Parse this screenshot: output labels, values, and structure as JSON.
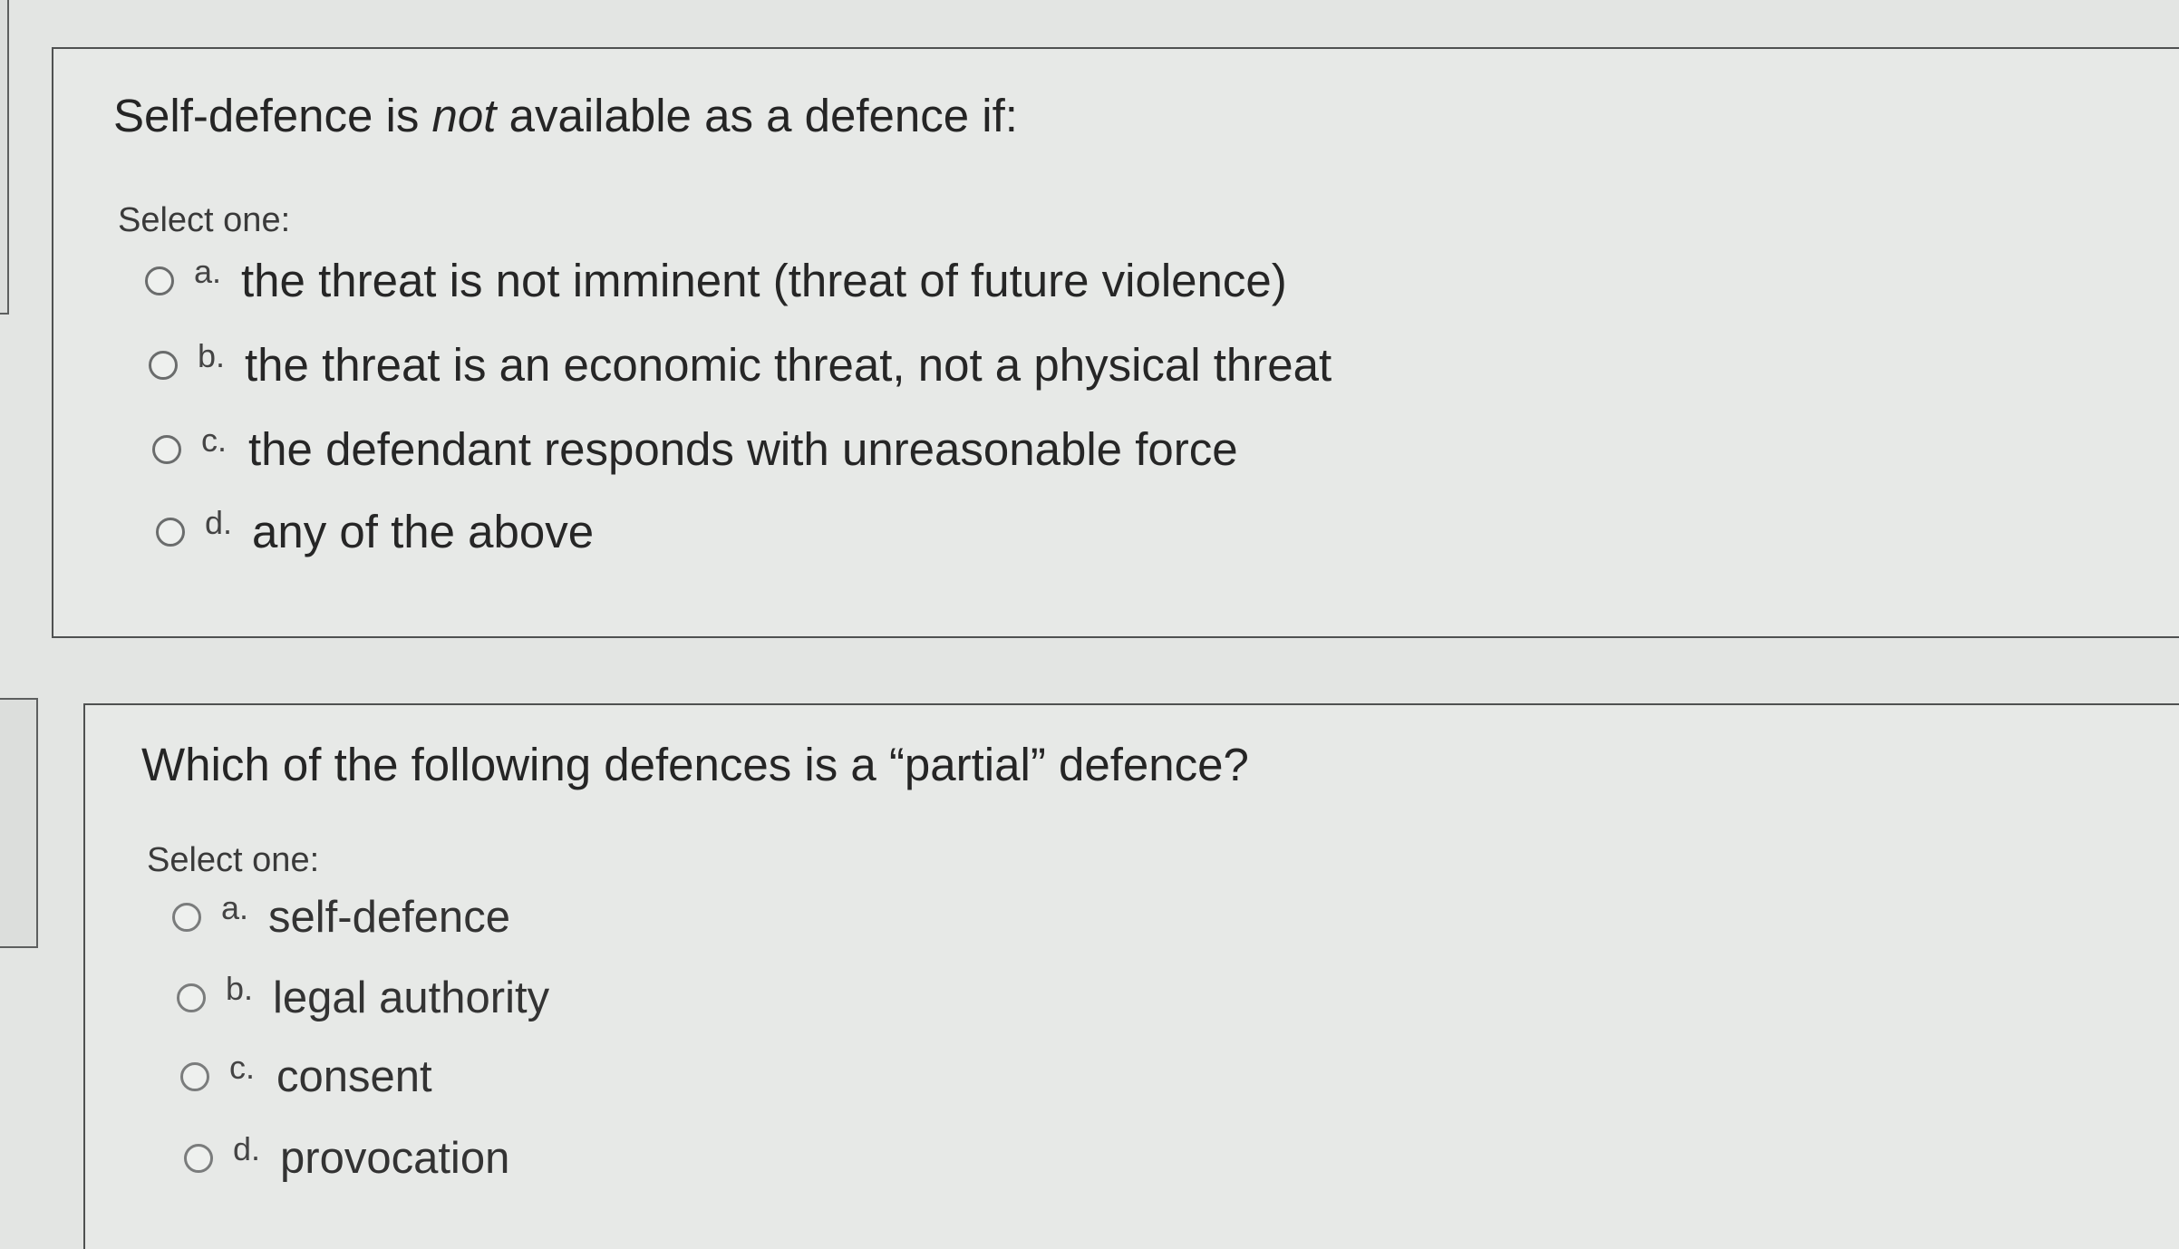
{
  "question1": {
    "text_before": "Self-defence is ",
    "text_emphasis": "not",
    "text_after": " available as a defence if:",
    "select_label": "Select one:",
    "options": [
      {
        "letter": "a.",
        "text": "the threat is not imminent (threat of future violence)"
      },
      {
        "letter": "b.",
        "text": "the threat is an economic threat, not a physical threat"
      },
      {
        "letter": "c.",
        "text": "the defendant responds with unreasonable force"
      },
      {
        "letter": "d.",
        "text": "any of the above"
      }
    ]
  },
  "question2": {
    "text": "Which of the following defences is a “partial” defence?",
    "select_label": "Select one:",
    "options": [
      {
        "letter": "a.",
        "text": "self-defence"
      },
      {
        "letter": "b.",
        "text": "legal authority"
      },
      {
        "letter": "c.",
        "text": "consent"
      },
      {
        "letter": "d.",
        "text": "provocation"
      }
    ]
  }
}
